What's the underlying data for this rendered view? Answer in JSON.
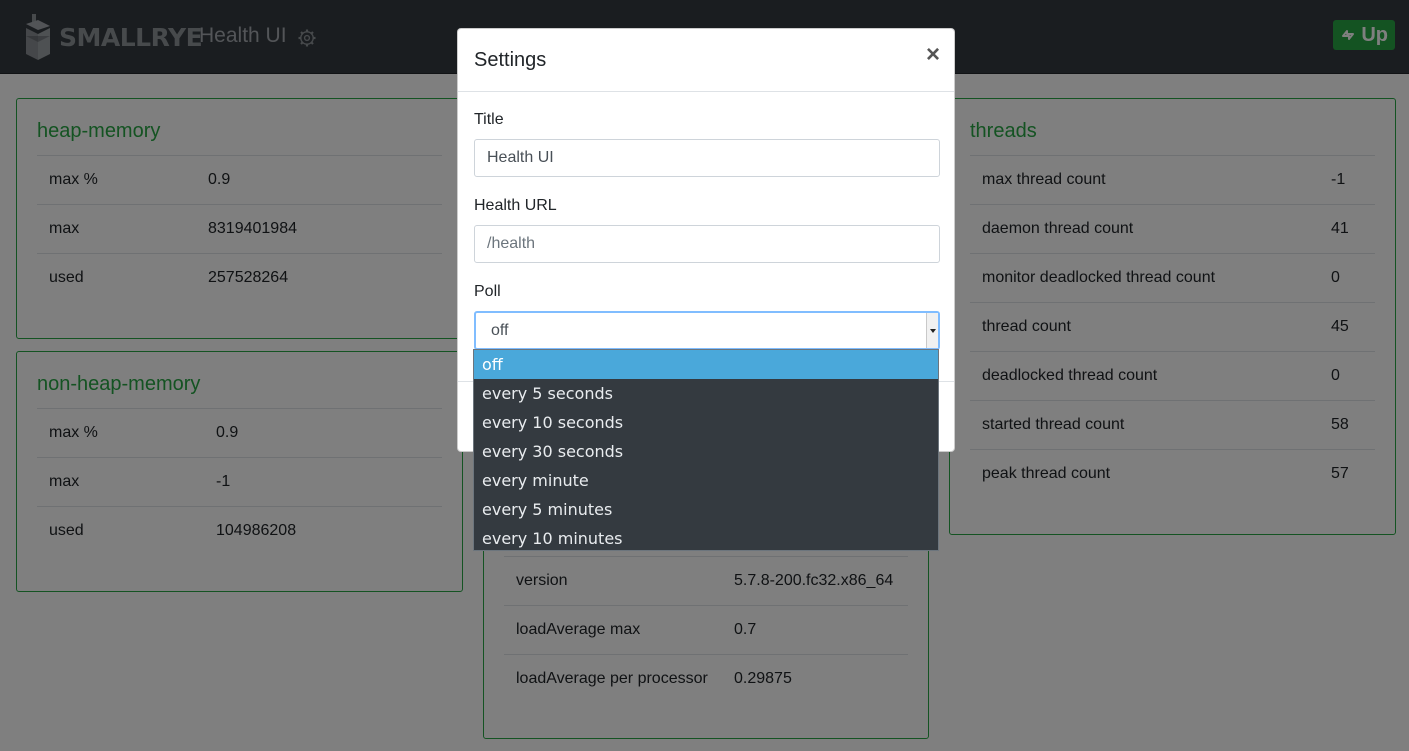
{
  "navbar": {
    "brand_left": "SMALL",
    "brand_right": "RYE",
    "title": "Health UI",
    "status": "Up"
  },
  "cards": {
    "heap": {
      "title": "heap-memory",
      "rows": [
        {
          "label": "max %",
          "value": "0.9"
        },
        {
          "label": "max",
          "value": "8319401984"
        },
        {
          "label": "used",
          "value": "257528264"
        }
      ]
    },
    "nonheap": {
      "title": "non-heap-memory",
      "rows": [
        {
          "label": "max %",
          "value": "0.9"
        },
        {
          "label": "max",
          "value": "-1"
        },
        {
          "label": "used",
          "value": "104986208"
        }
      ]
    },
    "os": {
      "rows": [
        {
          "label": "version",
          "value": "5.7.8-200.fc32.x86_64"
        },
        {
          "label": "loadAverage max",
          "value": "0.7"
        },
        {
          "label": "loadAverage per processor",
          "value": "0.29875"
        }
      ]
    },
    "threads": {
      "title": "threads",
      "rows": [
        {
          "label": "max thread count",
          "value": "-1"
        },
        {
          "label": "daemon thread count",
          "value": "41"
        },
        {
          "label": "monitor deadlocked thread count",
          "value": "0"
        },
        {
          "label": "thread count",
          "value": "45"
        },
        {
          "label": "deadlocked thread count",
          "value": "0"
        },
        {
          "label": "started thread count",
          "value": "58"
        },
        {
          "label": "peak thread count",
          "value": "57"
        }
      ]
    }
  },
  "modal": {
    "title": "Settings",
    "close": "×",
    "title_label": "Title",
    "title_value": "Health UI",
    "url_label": "Health URL",
    "url_placeholder": "/health",
    "poll_label": "Poll",
    "poll_value": "off",
    "poll_options": [
      "off",
      "every 5 seconds",
      "every 10 seconds",
      "every 30 seconds",
      "every minute",
      "every 5 minutes",
      "every 10 minutes"
    ]
  },
  "colors": {
    "accent": "#28a745",
    "navbar": "#343a40",
    "option_highlight": "#4aa8da"
  }
}
